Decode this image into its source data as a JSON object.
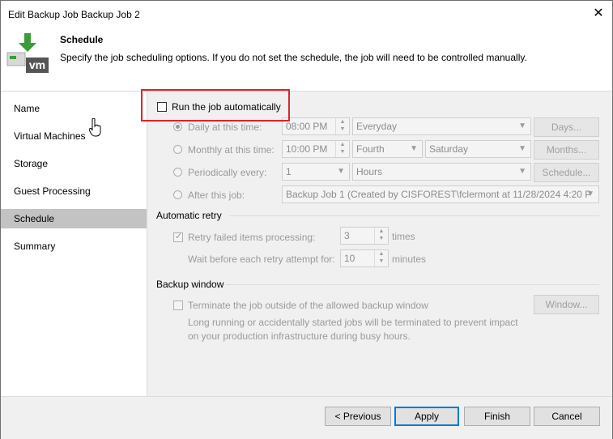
{
  "window": {
    "title": "Edit Backup Job Backup Job 2",
    "close": "✕"
  },
  "header": {
    "title": "Schedule",
    "description": "Specify the job scheduling options. If you do not set the schedule, the job will need to be controlled manually.",
    "logo_text": "vm"
  },
  "sidebar": {
    "items": [
      {
        "label": "Name",
        "active": false
      },
      {
        "label": "Virtual Machines",
        "active": false
      },
      {
        "label": "Storage",
        "active": false
      },
      {
        "label": "Guest Processing",
        "active": false
      },
      {
        "label": "Schedule",
        "active": true
      },
      {
        "label": "Summary",
        "active": false
      }
    ]
  },
  "schedule": {
    "run_auto": {
      "label": "Run the job automatically",
      "checked": false
    },
    "daily": {
      "label": "Daily at this time:",
      "time": "08:00 PM",
      "option": "Everyday",
      "button": "Days...",
      "selected": true
    },
    "monthly": {
      "label": "Monthly at this time:",
      "time": "10:00 PM",
      "week": "Fourth",
      "day": "Saturday",
      "button": "Months..."
    },
    "periodic": {
      "label": "Periodically every:",
      "value": "1",
      "unit": "Hours",
      "button": "Schedule..."
    },
    "after": {
      "label": "After this job:",
      "job": "Backup Job 1 (Created by CISFOREST\\fclermont at 11/28/2024 4:20 P"
    }
  },
  "retry": {
    "section": "Automatic retry",
    "retry_label": "Retry failed items processing:",
    "retry_count": "3",
    "times": "times",
    "wait_label": "Wait before each retry attempt for:",
    "wait_value": "10",
    "minutes": "minutes",
    "checked": true
  },
  "window_section": {
    "section": "Backup window",
    "terminate_label": "Terminate the job outside of the allowed backup window",
    "note_line1": "Long running or accidentally started jobs will be terminated to prevent impact",
    "note_line2": "on your production infrastructure during busy hours.",
    "button": "Window..."
  },
  "footer": {
    "previous": "< Previous",
    "apply": "Apply",
    "finish": "Finish",
    "cancel": "Cancel"
  },
  "colors": {
    "highlight": "#e0222a",
    "veeam_green": "#3a9c3a",
    "accent": "#0078d7"
  }
}
